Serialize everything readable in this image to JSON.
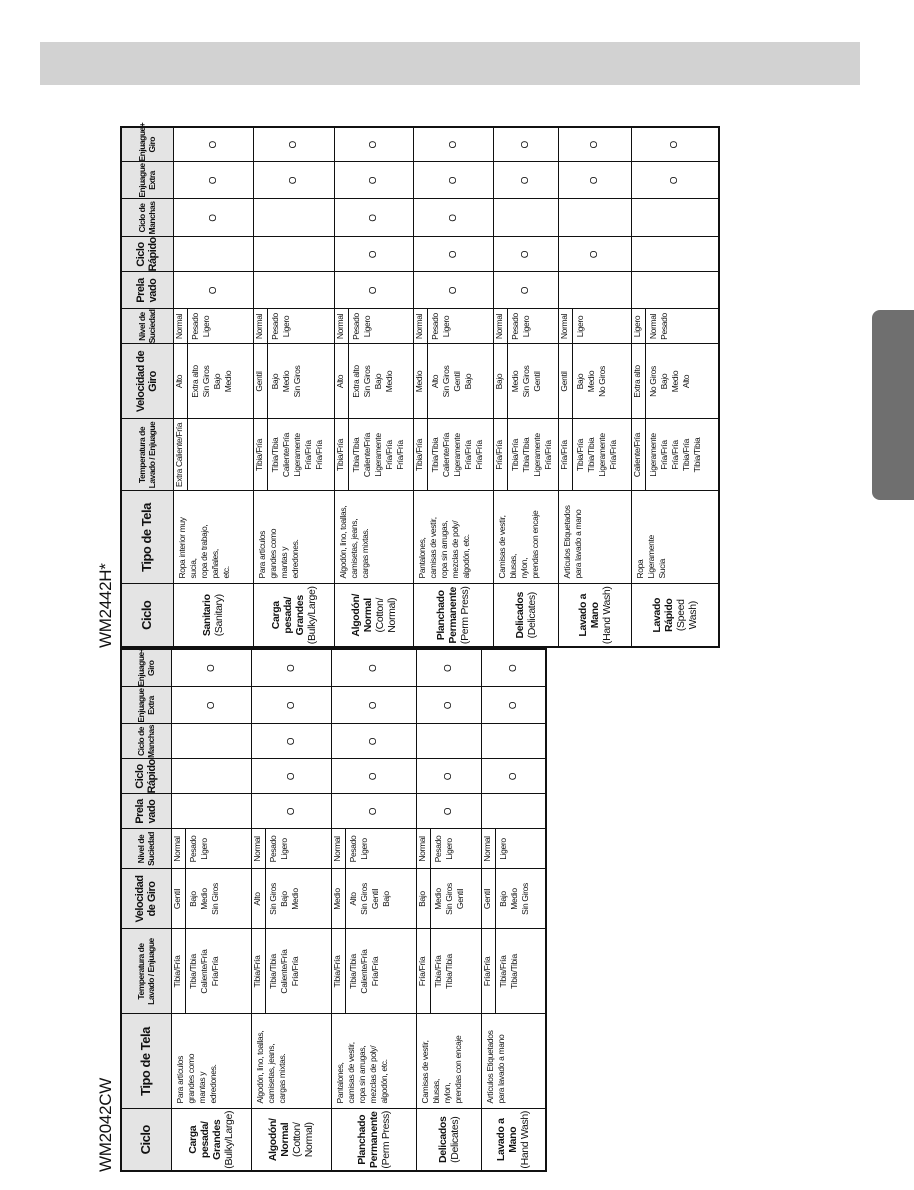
{
  "mark_symbol": "O",
  "colors": {
    "top_bar": "#d2d2d2",
    "side_tab": "#6f6f6f",
    "header_fill": "#e4e4e4"
  },
  "headers": [
    "Ciclo",
    "Tipo de Tela",
    "Temperatura de Lavado / Enjuague",
    "Velocidad de Giro",
    "Nivel de Suciedad",
    "Prela vado",
    "Ciclo Rápido",
    "Ciclo de Manchas",
    "Enjuague Extra",
    "Enjuague+ Giro"
  ],
  "tables": [
    {
      "model": "WM2442H*",
      "rows": [
        {
          "name": "Sanitario",
          "en": "(Sanitary)",
          "tipo": "Ropa interior muy\nsucia,\nropa de trabajo,\npañales,\netc.",
          "temp": [
            "Extra Caliente/Fría",
            ""
          ],
          "vel": [
            "Alto",
            "Extra alto\nSin Giros\nBajo\nMedio"
          ],
          "nivel": [
            "Normal",
            "Pesado\nLigero"
          ],
          "marks": [
            true,
            false,
            true,
            true,
            true
          ]
        },
        {
          "name": "Carga pesada/ Grandes",
          "en": "(Bulky/Large)",
          "tipo": "Para artículos\ngrandes como\nmantas y\nedredones.",
          "temp": [
            "Tibia/Fría",
            "Tibia/Tibia\nCaliente/Fría\nLigeramente Fría/Fría\nFría/Fría"
          ],
          "vel": [
            "Gentil",
            "Bajo\nMedio\nSin Giros"
          ],
          "nivel": [
            "Normal",
            "Pesado\nLigero"
          ],
          "marks": [
            false,
            false,
            false,
            true,
            true
          ]
        },
        {
          "name": "Algodón/ Normal",
          "en": "(Cotton/ Normal)",
          "tipo": "Algodón, lino, toallas,\ncamisetas, jeans,\ncargas mixtas.",
          "temp": [
            "Tibia/Fría",
            "Tibia/Tibia\nCaliente/Fría\nLigeramente Fría/Fría\nFría/Fría"
          ],
          "vel": [
            "Alto",
            "Extra alto\nSin Giros\nBajo\nMedio"
          ],
          "nivel": [
            "Normal",
            "Pesado\nLigero"
          ],
          "marks": [
            true,
            true,
            true,
            true,
            true
          ]
        },
        {
          "name": "Planchado Permanente",
          "en": "(Perm Press)",
          "tipo": "Pantalones,\ncamisas de vestir,\nropa sin arrugas,\nmezclas de poly/\nalgodón, etc.",
          "temp": [
            "Tibia/Fría",
            "Tibia/Tibia\nCaliente/Fría\nLigeramente Fría/Fría\nFría/Fría"
          ],
          "vel": [
            "Medio",
            "Alto\nSin Giros\nGentil\nBajo"
          ],
          "nivel": [
            "Normal",
            "Pesado\nLigero"
          ],
          "marks": [
            true,
            true,
            true,
            true,
            true
          ]
        },
        {
          "name": "Delicados",
          "en": "(Delicates)",
          "tipo": "Camisas de vestir,\nblusas,\nnylon,\nprendas con encaje",
          "temp": [
            "Fría/Fría",
            "Tibia/Fría\nTibia/Tibia\nLigeramente Fría/Fría"
          ],
          "vel": [
            "Bajo",
            "Medio\nSin Giros\nGentil"
          ],
          "nivel": [
            "Normal",
            "Pesado\nLigero"
          ],
          "marks": [
            true,
            true,
            false,
            true,
            true
          ]
        },
        {
          "name": "Lavado a Mano",
          "en": "(Hand Wash)",
          "tipo": "Artículos Etiquetados\npara lavado a mano",
          "temp": [
            "Fría/Fría",
            "Tibia/Fría\nTibia/Tibia\nLigeramente Fría/Fría"
          ],
          "vel": [
            "Gentil",
            "Bajo\nMedio\nNo Giros"
          ],
          "nivel": [
            "Normal",
            "Ligero"
          ],
          "marks": [
            false,
            true,
            false,
            true,
            true
          ]
        },
        {
          "name": "Lavado Rápido",
          "en": "(Speed Wash)",
          "tipo": "Ropa\nLigeramente\nSucia",
          "temp": [
            "Caliente/Fría",
            "Ligeramente Fría/Fría\nFría/Fría\nTibia/Fría\nTibia/Tibia"
          ],
          "vel": [
            "Extra alto",
            "No Giros\nBajo\nMedio\nAlto"
          ],
          "nivel": [
            "Ligero",
            "Normal\nPesado"
          ],
          "marks": [
            false,
            false,
            false,
            true,
            true
          ]
        }
      ]
    },
    {
      "model": "WM2042CW",
      "rows": [
        {
          "name": "Carga pesada/ Grandes",
          "en": "(Bulky/Large)",
          "tipo": "Para artículos\ngrandes como\nmantas y\nedredones.",
          "temp": [
            "Tibia/Fría",
            "Tibia/Tibia\nCaliente/Fría\nFría/Fría"
          ],
          "vel": [
            "Gentil",
            "Bajo\nMedio\nSin Giros"
          ],
          "nivel": [
            "Normal",
            "Pesado\nLigero"
          ],
          "marks": [
            false,
            false,
            false,
            true,
            true
          ]
        },
        {
          "name": "Algodón/ Normal",
          "en": "(Cotton/ Normal)",
          "tipo": "Algodón, lino, toallas,\ncamisetas, jeans,\ncargas mixtas.",
          "temp": [
            "Tibia/Fría",
            "Tibia/Tibia\nCaliente/Fría\nFría/Fría"
          ],
          "vel": [
            "Alto",
            "Sin Giros\nBajo\nMedio"
          ],
          "nivel": [
            "Normal",
            "Pesado\nLigero"
          ],
          "marks": [
            true,
            true,
            true,
            true,
            true
          ]
        },
        {
          "name": "Planchado Permanente",
          "en": "(Perm Press)",
          "tipo": "Pantalones,\ncamisas de vestir,\nropa sin arrugas,\nmezclas de poly/\nalgodón, etc.",
          "temp": [
            "Tibia/Fría",
            "Tibia/Tibia\nCaliente/Fría\nFría/Fría"
          ],
          "vel": [
            "Medio",
            "Alto\nSin Giros\nGentil\nBajo"
          ],
          "nivel": [
            "Normal",
            "Pesado\nLigero"
          ],
          "marks": [
            true,
            true,
            true,
            true,
            true
          ]
        },
        {
          "name": "Delicados",
          "en": "(Delicates)",
          "tipo": "Camisas de vestir,\nblusas,\nnylon,\nprendas con encaje",
          "temp": [
            "Fría/Fría",
            "Tibia/Fría\nTibia/Tibia"
          ],
          "vel": [
            "Bajo",
            "Medio\nSin Giros\nGentil"
          ],
          "nivel": [
            "Normal",
            "Pesado\nLigero"
          ],
          "marks": [
            true,
            true,
            false,
            true,
            true
          ]
        },
        {
          "name": "Lavado a Mano",
          "en": "(Hand Wash)",
          "tipo": "Artículos Etiquetados\npara lavado a mano",
          "temp": [
            "Fría/Fría",
            "Tibia/Fría\nTibia/Tibia"
          ],
          "vel": [
            "Gentil",
            "Bajo\nMedio\nSin Giros"
          ],
          "nivel": [
            "Normal",
            "Ligero"
          ],
          "marks": [
            false,
            true,
            false,
            true,
            true
          ]
        }
      ]
    }
  ]
}
